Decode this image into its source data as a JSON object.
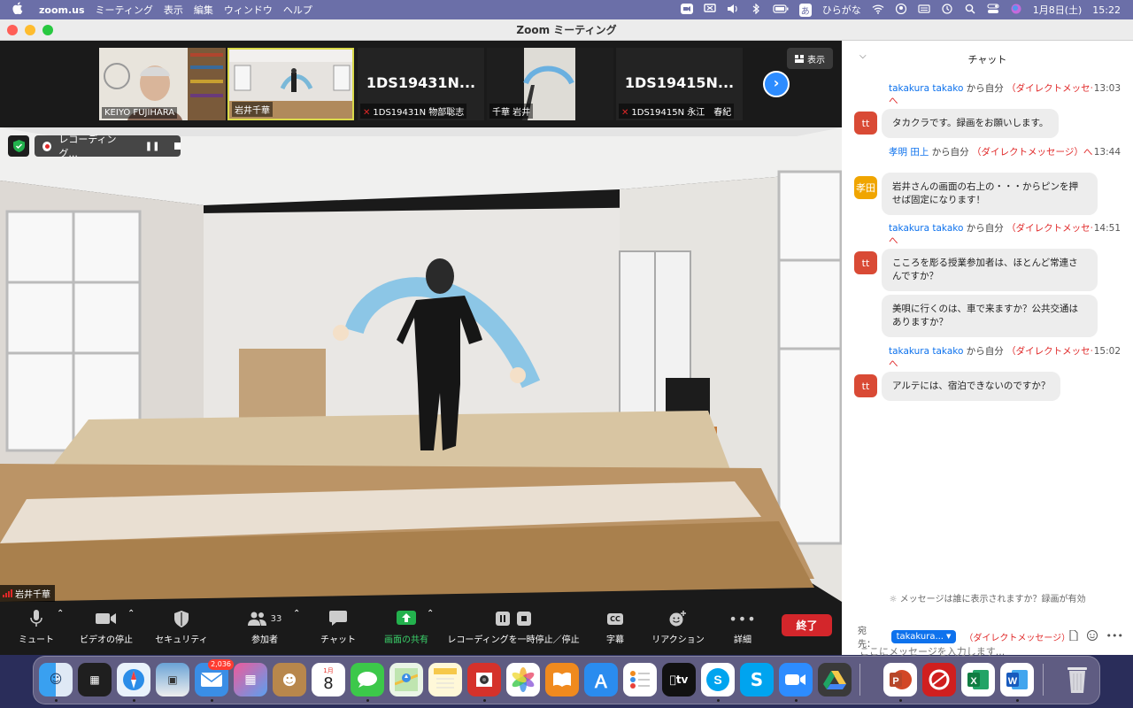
{
  "menubar": {
    "app_name": "zoom.us",
    "menus": [
      "ミーティング",
      "表示",
      "編集",
      "ウィンドウ",
      "ヘルプ"
    ],
    "input_mode_icon": "あ",
    "input_mode": "ひらがな",
    "date": "1月8日(土)",
    "time": "15:22"
  },
  "window": {
    "title": "Zoom ミーティング"
  },
  "gallery": {
    "view_label": "表示",
    "thumbs": [
      {
        "name": "KEIYO FUJIHARA",
        "big": ""
      },
      {
        "name": "岩井千華",
        "big": ""
      },
      {
        "name": "1DS19431N 物部聡志",
        "big": "1DS19431N..."
      },
      {
        "name": "千華 岩井",
        "big": ""
      },
      {
        "name": "1DS19415N 永江　春紀",
        "big": "1DS19415N..."
      }
    ]
  },
  "video": {
    "recording_label": "レコーディング...",
    "speaker_name": "岩井千華"
  },
  "toolbar": {
    "mute": "ミュート",
    "video": "ビデオの停止",
    "security": "セキュリティ",
    "participants": "参加者",
    "participants_count": "33",
    "chat": "チャット",
    "share": "画面の共有",
    "recording": "レコーディングを一時停止／停止",
    "captions": "字幕",
    "captions_icon": "CC",
    "reactions": "リアクション",
    "more": "詳細",
    "end": "終了"
  },
  "chat": {
    "title": "チャット",
    "messages": [
      {
        "sender": "takakura takako",
        "to": "から自分",
        "dm": "（ダイレクトメッセージ）へ",
        "time": "13:03",
        "avatar": "tt",
        "text": "タカクラです。録画をお願いします。"
      },
      {
        "sender": "孝明 田上",
        "to": "から自分",
        "dm": "（ダイレクトメッセージ）へ",
        "time": "13:44",
        "avatar": "孝田",
        "text": "岩井さんの画面の右上の・・・からピンを押せば固定になります！"
      },
      {
        "sender": "takakura takako",
        "to": "から自分",
        "dm": "（ダイレクトメッセージ）へ",
        "time": "14:51",
        "avatar": "tt",
        "text": "こころを彫る授業参加者は、ほとんど常連さんですか？"
      },
      {
        "text": "美唄に行くのは、車で来ますか？公共交通はありますか？"
      },
      {
        "sender": "takakura takako",
        "to": "から自分",
        "dm": "（ダイレクトメッセージ）へ",
        "time": "15:02",
        "avatar": "tt",
        "text": "アルテには、宿泊できないのですか？"
      }
    ],
    "visibility_note": "メッセージは誰に表示されますか？録画が有効",
    "to_label": "宛先：",
    "to_value": "takakura...",
    "to_dm": "（ダイレクトメッセージ）",
    "input_placeholder": "ここにメッセージを入力します..."
  },
  "dock": {
    "mail_badge": "2,036",
    "calendar_month": "1月",
    "calendar_day": "8",
    "tv_label": "tv"
  }
}
